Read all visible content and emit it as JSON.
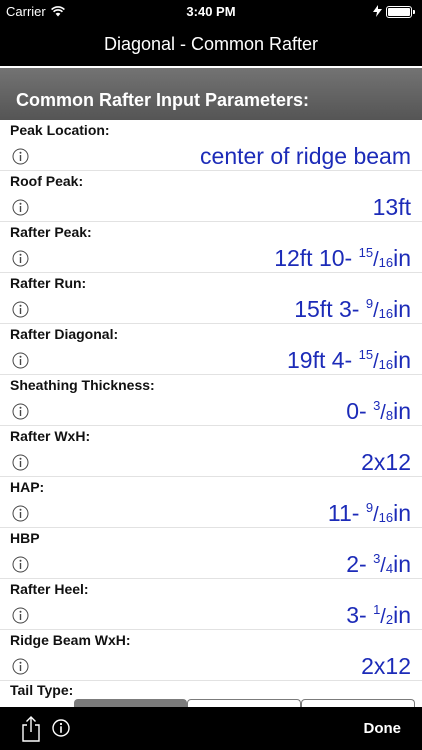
{
  "status_bar": {
    "carrier": "Carrier",
    "time": "3:40 PM",
    "icons": [
      "wifi-icon",
      "charging-icon",
      "battery-icon"
    ]
  },
  "nav_bar": {
    "title": "Diagonal - Common Rafter"
  },
  "section": {
    "title": "Common Rafter Input Parameters:"
  },
  "rows": [
    {
      "label": "Peak Location:",
      "value": "center of ridge beam"
    },
    {
      "label": "Roof Peak:",
      "value": "13ft"
    },
    {
      "label": "Rafter Peak:",
      "value_main": "12ft 10- ",
      "num": "15",
      "den": "16",
      "unit": "in"
    },
    {
      "label": "Rafter Run:",
      "value_main": "15ft 3- ",
      "num": "9",
      "den": "16",
      "unit": "in"
    },
    {
      "label": "Rafter Diagonal:",
      "value_main": "19ft 4- ",
      "num": "15",
      "den": "16",
      "unit": "in"
    },
    {
      "label": "Sheathing Thickness:",
      "value_main": "0- ",
      "num": "3",
      "den": "8",
      "unit": "in"
    },
    {
      "label": "Rafter WxH:",
      "value": "2x12"
    },
    {
      "label": "HAP:",
      "value_main": "11- ",
      "num": "9",
      "den": "16",
      "unit": "in"
    },
    {
      "label": "HBP",
      "value_main": "2- ",
      "num": "3",
      "den": "4",
      "unit": "in"
    },
    {
      "label": "Rafter Heel:",
      "value_main": "3- ",
      "num": "1",
      "den": "2",
      "unit": "in"
    },
    {
      "label": "Ridge Beam WxH:",
      "value": "2x12"
    }
  ],
  "tail_type": {
    "label": "Tail Type:"
  },
  "toolbar": {
    "done_label": "Done",
    "icons": [
      "share-icon",
      "info-icon"
    ]
  },
  "colors": {
    "value_text": "#1c2bb8",
    "bar_background": "#000000",
    "header_gray": "#636363"
  }
}
